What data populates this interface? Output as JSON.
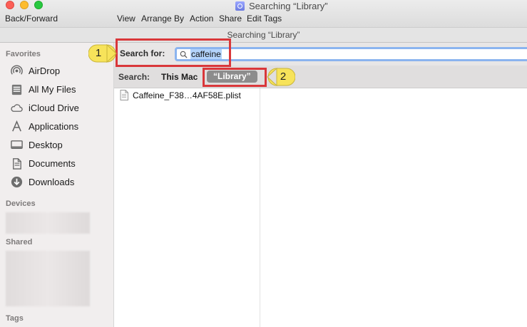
{
  "window": {
    "title": "Searching “Library”",
    "path_title": "Searching “Library”"
  },
  "toolbar": {
    "back_forward": "Back/Forward",
    "view": "View",
    "arrange_by": "Arrange By",
    "action": "Action",
    "share": "Share",
    "edit_tags": "Edit Tags"
  },
  "sidebar": {
    "favorites_heading": "Favorites",
    "items": [
      {
        "label": "AirDrop",
        "icon": "airdrop-icon"
      },
      {
        "label": "All My Files",
        "icon": "all-my-files-icon"
      },
      {
        "label": "iCloud Drive",
        "icon": "cloud-icon"
      },
      {
        "label": "Applications",
        "icon": "applications-icon"
      },
      {
        "label": "Desktop",
        "icon": "desktop-icon"
      },
      {
        "label": "Documents",
        "icon": "documents-icon"
      },
      {
        "label": "Downloads",
        "icon": "downloads-icon"
      }
    ],
    "devices_heading": "Devices",
    "shared_heading": "Shared",
    "tags_heading": "Tags"
  },
  "search": {
    "label": "Search for:",
    "value": "caffeine"
  },
  "scope": {
    "label": "Search:",
    "this_mac": "This Mac",
    "library": "“Library”"
  },
  "results": [
    {
      "name": "Caffeine_F38…4AF58E.plist",
      "icon": "plist-file-icon"
    }
  ],
  "annotations": {
    "callout_1": "1",
    "callout_2": "2",
    "box_color": "#d9373a",
    "callout_color": "#f7e35a"
  }
}
